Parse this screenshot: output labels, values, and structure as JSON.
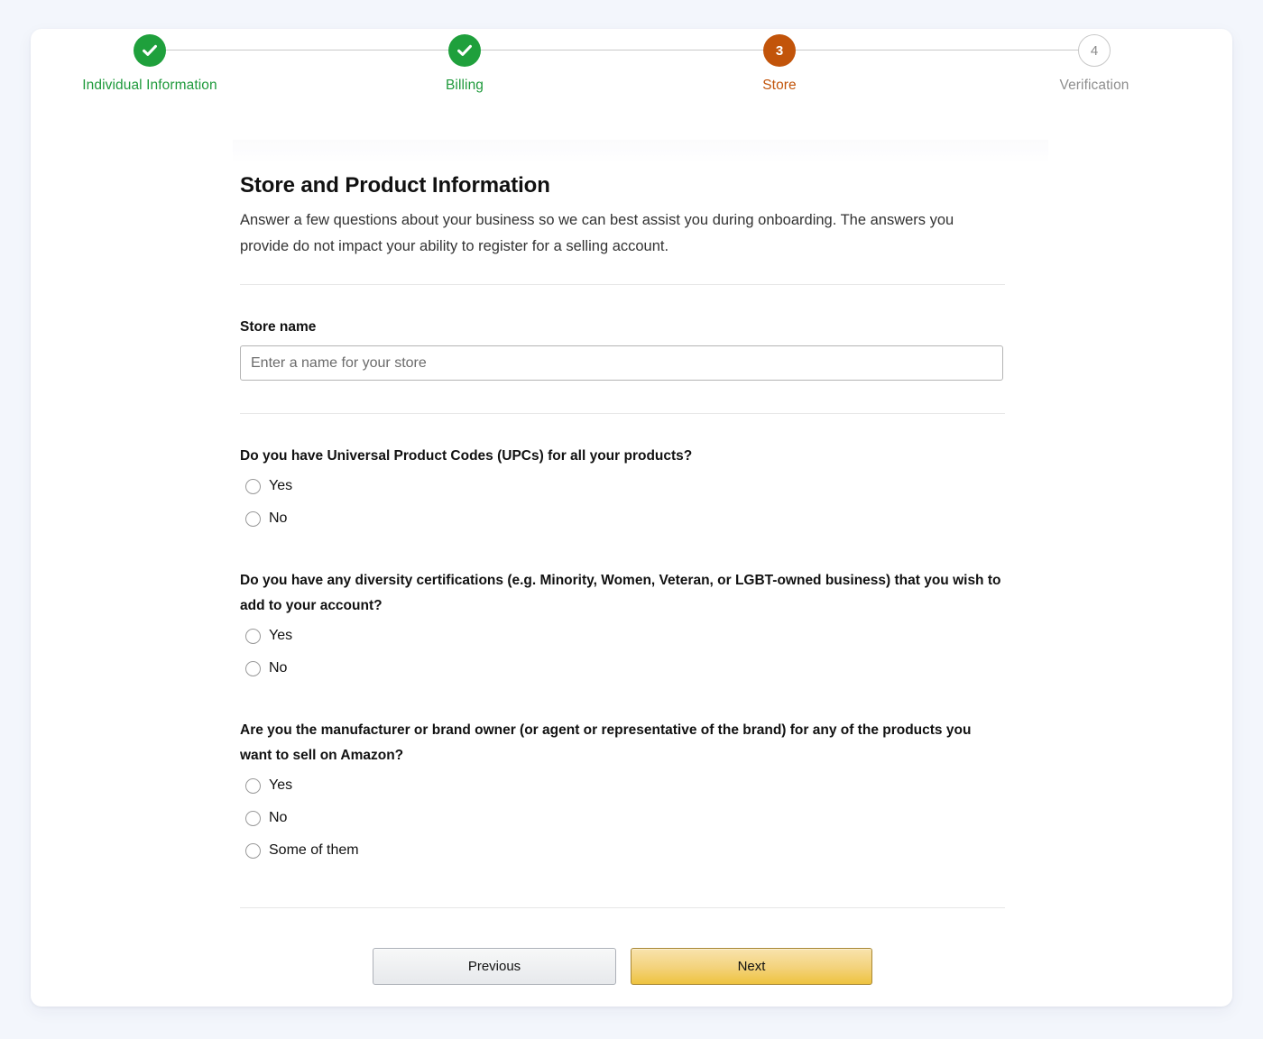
{
  "stepper": {
    "steps": [
      {
        "label": "Individual Information",
        "state": "done",
        "marker": "check-icon"
      },
      {
        "label": "Billing",
        "state": "done",
        "marker": "check-icon"
      },
      {
        "label": "Store",
        "state": "current",
        "marker": "3"
      },
      {
        "label": "Verification",
        "state": "upcoming",
        "marker": "4"
      }
    ],
    "colors": {
      "done": "#1fa03c",
      "current": "#c2540a",
      "upcoming": "#8e8e8e",
      "connector": "#c9c9c9"
    }
  },
  "form": {
    "title": "Store and Product Information",
    "description": "Answer a few questions about your business so we can best assist you during onboarding. The answers you provide do not impact your ability to register for a selling account.",
    "store_name": {
      "label": "Store name",
      "value": "",
      "placeholder": "Enter a name for your store"
    },
    "questions": [
      {
        "text": "Do you have Universal Product Codes (UPCs) for all your products?",
        "options": [
          "Yes",
          "No"
        ]
      },
      {
        "text": "Do you have any diversity certifications (e.g. Minority, Women, Veteran, or LGBT-owned business) that you wish to add to your account?",
        "options": [
          "Yes",
          "No"
        ]
      },
      {
        "text": "Are you the manufacturer or brand owner (or agent or representative of the brand) for any of the products you want to sell on Amazon?",
        "options": [
          "Yes",
          "No",
          "Some of them"
        ]
      }
    ]
  },
  "actions": {
    "previous_label": "Previous",
    "next_label": "Next",
    "next_color": "#f0c14b"
  }
}
